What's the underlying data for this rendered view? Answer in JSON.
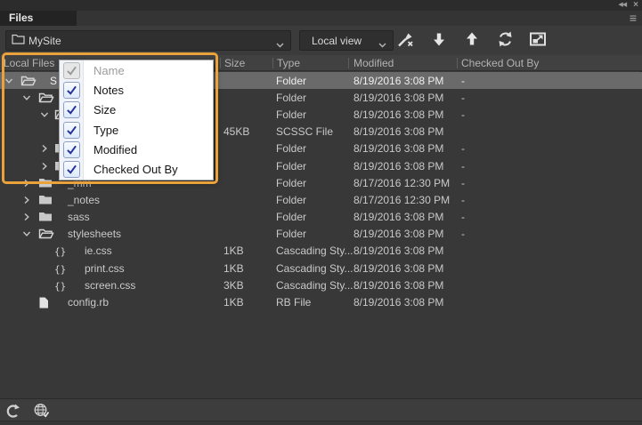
{
  "window": {
    "collapse_icon": "double-left-arrow",
    "close_icon": "x",
    "panel_menu_icon": "hamburger"
  },
  "tabs": {
    "active_label": "Files"
  },
  "toolbar": {
    "site_selector": {
      "value": "MySite",
      "icon": "folder-outline-icon"
    },
    "view_selector": {
      "value": "Local view"
    },
    "buttons": [
      {
        "icon": "connect-to-remote-server-icon"
      },
      {
        "icon": "get-files-down-arrow-icon"
      },
      {
        "icon": "put-files-up-arrow-icon"
      },
      {
        "icon": "refresh-icon"
      },
      {
        "icon": "expand-panel-icon"
      }
    ]
  },
  "columns": [
    "Local Files",
    "Size",
    "Type",
    "Modified",
    "Checked Out By"
  ],
  "filelist": {
    "rows": [
      {
        "chevron": "down",
        "icon": "folder-open",
        "level": 1,
        "name": "S",
        "size": "",
        "type": "Folder",
        "modified": "8/19/2016 3:08 PM",
        "checked_out": "-",
        "selected": true
      },
      {
        "chevron": "down",
        "icon": "folder-open",
        "level": 2,
        "name": "",
        "size": "",
        "type": "Folder",
        "modified": "8/19/2016 3:08 PM",
        "checked_out": "-",
        "selected": false
      },
      {
        "chevron": "down",
        "icon": "folder-open",
        "level": 3,
        "name": "",
        "size": "",
        "type": "Folder",
        "modified": "8/19/2016 3:08 PM",
        "checked_out": "-",
        "selected": false
      },
      {
        "chevron": "none",
        "icon": "none",
        "level": 4,
        "name": "",
        "size": "45KB",
        "type": "SCSSC File",
        "modified": "8/19/2016 3:08 PM",
        "checked_out": "",
        "selected": false
      },
      {
        "chevron": "right",
        "icon": "folder",
        "level": 3,
        "name": "",
        "size": "",
        "type": "Folder",
        "modified": "8/19/2016 3:08 PM",
        "checked_out": "-",
        "selected": false
      },
      {
        "chevron": "right",
        "icon": "folder",
        "level": 3,
        "name": "",
        "size": "",
        "type": "Folder",
        "modified": "8/19/2016 3:08 PM",
        "checked_out": "-",
        "selected": false
      },
      {
        "chevron": "right",
        "icon": "folder",
        "level": 2,
        "name": "_mm",
        "size": "",
        "type": "Folder",
        "modified": "8/17/2016 12:30 PM",
        "checked_out": "-",
        "selected": false
      },
      {
        "chevron": "right",
        "icon": "folder",
        "level": 2,
        "name": "_notes",
        "size": "",
        "type": "Folder",
        "modified": "8/17/2016 12:30 PM",
        "checked_out": "-",
        "selected": false
      },
      {
        "chevron": "right",
        "icon": "folder",
        "level": 2,
        "name": "sass",
        "size": "",
        "type": "Folder",
        "modified": "8/19/2016 3:08 PM",
        "checked_out": "-",
        "selected": false
      },
      {
        "chevron": "down",
        "icon": "folder-open",
        "level": 2,
        "name": "stylesheets",
        "size": "",
        "type": "Folder",
        "modified": "8/19/2016 3:08 PM",
        "checked_out": "-",
        "selected": false
      },
      {
        "chevron": "none",
        "icon": "braces",
        "level": 3,
        "name": "ie.css",
        "size": "1KB",
        "type": "Cascading Sty...",
        "modified": "8/19/2016 3:08 PM",
        "checked_out": "",
        "selected": false
      },
      {
        "chevron": "none",
        "icon": "braces",
        "level": 3,
        "name": "print.css",
        "size": "1KB",
        "type": "Cascading Sty...",
        "modified": "8/19/2016 3:08 PM",
        "checked_out": "",
        "selected": false
      },
      {
        "chevron": "none",
        "icon": "braces",
        "level": 3,
        "name": "screen.css",
        "size": "3KB",
        "type": "Cascading Sty...",
        "modified": "8/19/2016 3:08 PM",
        "checked_out": "",
        "selected": false
      },
      {
        "chevron": "none",
        "icon": "page",
        "level": 2,
        "name": "config.rb",
        "size": "1KB",
        "type": "RB File",
        "modified": "8/19/2016 3:08 PM",
        "checked_out": "",
        "selected": false
      }
    ]
  },
  "context_menu": {
    "items": [
      {
        "label": "Name",
        "checked": true,
        "disabled": true
      },
      {
        "label": "Notes",
        "checked": true,
        "disabled": false
      },
      {
        "label": "Size",
        "checked": true,
        "disabled": false
      },
      {
        "label": "Type",
        "checked": true,
        "disabled": false
      },
      {
        "label": "Modified",
        "checked": true,
        "disabled": false
      },
      {
        "label": "Checked Out By",
        "checked": true,
        "disabled": false
      }
    ]
  },
  "statusbar": {
    "icons": [
      "refresh-status-icon",
      "globe-check-icon"
    ]
  },
  "colors": {
    "highlight_orange": "#E9A23C",
    "check_navy": "#26339B",
    "selected_row": "#6A6A6A",
    "panel_bg": "#3B3B3B",
    "menu_bg": "#FFFFFF"
  }
}
